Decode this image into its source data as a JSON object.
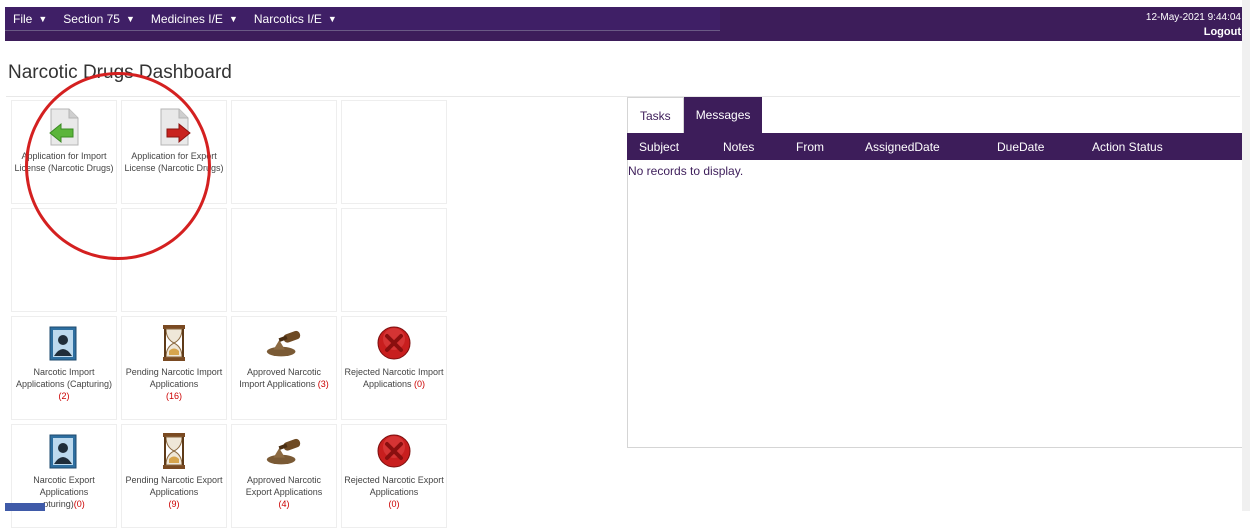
{
  "menu": {
    "items": [
      {
        "label": "File"
      },
      {
        "label": "Section 75"
      },
      {
        "label": "Medicines I/E"
      },
      {
        "label": "Narcotics I/E"
      }
    ],
    "caret": "▼"
  },
  "header": {
    "datetime": "12-May-2021 9:44:04",
    "logout": "Logout"
  },
  "page": {
    "title": "Narcotic Drugs Dashboard"
  },
  "tiles": {
    "import_license": {
      "label": "Application for Import License (Narcotic Drugs)",
      "icon": "import-document-icon"
    },
    "export_license": {
      "label": "Application for Export License (Narcotic Drugs)",
      "icon": "export-document-icon"
    },
    "import_capturing": {
      "label": "Narcotic Import Applications (Capturing)",
      "count": "(2)",
      "icon": "contact-card-icon"
    },
    "import_pending": {
      "label": "Pending Narcotic Import Applications",
      "count": "(16)",
      "icon": "hourglass-icon"
    },
    "import_approved": {
      "label": "Approved Narcotic Import Applications",
      "count": "(3)",
      "icon": "stamp-icon"
    },
    "import_rejected": {
      "label": "Rejected Narcotic Import Applications",
      "count": "(0)",
      "icon": "reject-icon"
    },
    "export_capturing": {
      "label": "Narcotic Export Applications",
      "label_tail": "pturing)",
      "count": "(0)",
      "icon": "contact-card-icon"
    },
    "export_pending": {
      "label": "Pending Narcotic Export Applications",
      "count": "(9)",
      "icon": "hourglass-icon"
    },
    "export_approved": {
      "label": "Approved Narcotic Export Applications",
      "count": "(4)",
      "icon": "stamp-icon"
    },
    "export_rejected": {
      "label": "Rejected Narcotic Export Applications",
      "count": "(0)",
      "icon": "reject-icon"
    }
  },
  "panel": {
    "tabs": [
      {
        "label": "Tasks"
      },
      {
        "label": "Messages"
      }
    ],
    "columns": [
      "Subject",
      "Notes",
      "From",
      "AssignedDate",
      "DueDate",
      "Action Status"
    ],
    "empty_text": "No records to display."
  },
  "colors": {
    "brand": "#3d1d5a",
    "count": "#cc0000",
    "highlight_circle": "#d42020"
  }
}
